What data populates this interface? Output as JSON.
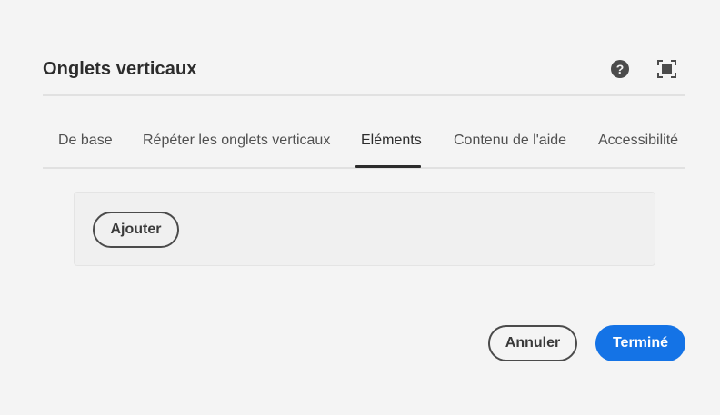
{
  "dialog": {
    "title": "Onglets verticaux",
    "help_icon": "help-circle-icon",
    "fullscreen_icon": "fullscreen-icon"
  },
  "tabs": [
    {
      "label": "De base",
      "selected": false
    },
    {
      "label": "Répéter les onglets verticaux",
      "selected": false
    },
    {
      "label": "Eléments",
      "selected": true
    },
    {
      "label": "Contenu de l'aide",
      "selected": false
    },
    {
      "label": "Accessibilité",
      "selected": false
    }
  ],
  "panel": {
    "add_label": "Ajouter"
  },
  "footer": {
    "cancel_label": "Annuler",
    "done_label": "Terminé"
  },
  "colors": {
    "background": "#f4f4f4",
    "primary": "#1473e6",
    "text": "#2c2c2c"
  }
}
